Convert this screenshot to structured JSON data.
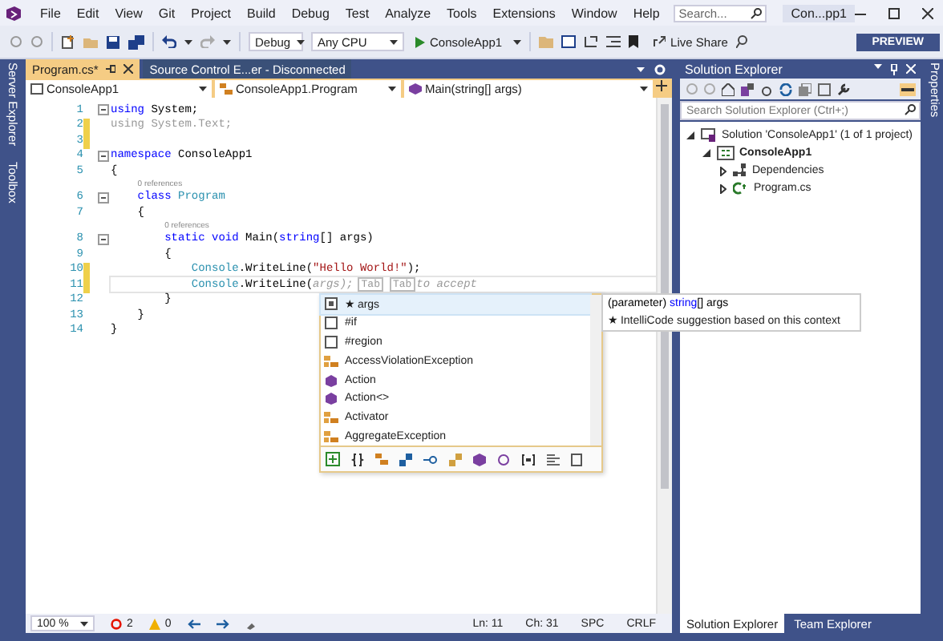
{
  "menu": {
    "items": [
      "File",
      "Edit",
      "View",
      "Git",
      "Project",
      "Build",
      "Debug",
      "Test",
      "Analyze",
      "Tools",
      "Extensions",
      "Window",
      "Help"
    ],
    "search": {
      "placeholder": "Search..."
    },
    "title": "Con...pp1"
  },
  "toolbar": {
    "config": "Debug",
    "platform": "Any CPU",
    "run_target": "ConsoleApp1",
    "live_share": "Live Share",
    "preview": "PREVIEW"
  },
  "side_left": [
    "Server Explorer",
    "Toolbox"
  ],
  "side_right": [
    "Properties"
  ],
  "tabs": [
    {
      "label": "Program.cs*",
      "selected": true
    },
    {
      "label": "Source Control E...er - Disconnected",
      "selected": false
    }
  ],
  "nav": [
    "ConsoleApp1",
    "ConsoleApp1.Program",
    "Main(string[] args)"
  ],
  "code": [
    {
      "kind": "line",
      "number": "1",
      "changed": false,
      "collapsible": true,
      "current": false,
      "tokens": [
        {
          "text": "using",
          "kind": "kw"
        },
        {
          "text": " System;",
          "kind": "plain"
        }
      ]
    },
    {
      "kind": "line",
      "number": "2",
      "changed": true,
      "collapsible": false,
      "current": false,
      "tokens": [
        {
          "text": "using System.Text;",
          "kind": "unused"
        }
      ]
    },
    {
      "kind": "line",
      "number": "3",
      "changed": true,
      "collapsible": false,
      "current": false
    },
    {
      "kind": "line",
      "number": "4",
      "changed": false,
      "collapsible": true,
      "current": false,
      "tokens": [
        {
          "text": "namespace",
          "kind": "kw"
        },
        {
          "text": " ConsoleApp1",
          "kind": "plain"
        }
      ]
    },
    {
      "kind": "line",
      "number": "5",
      "changed": false,
      "collapsible": false,
      "current": false,
      "tokens": [
        {
          "text": "{",
          "kind": "plain"
        }
      ]
    },
    {
      "kind": "codelens",
      "text": "0 references"
    },
    {
      "kind": "line",
      "number": "6",
      "changed": false,
      "collapsible": true,
      "current": false,
      "tokens": [
        {
          "text": "    class",
          "kind": "kw"
        },
        {
          "text": " Program",
          "kind": "type"
        }
      ]
    },
    {
      "kind": "line",
      "number": "7",
      "changed": false,
      "collapsible": false,
      "current": false,
      "tokens": [
        {
          "text": "    {",
          "kind": "plain"
        }
      ]
    },
    {
      "kind": "codelens",
      "text": "0 references"
    },
    {
      "kind": "line",
      "number": "8",
      "changed": false,
      "collapsible": true,
      "current": false,
      "tokens": [
        {
          "text": "        static void",
          "kind": "kw"
        },
        {
          "text": " Main(",
          "kind": "plain"
        },
        {
          "text": "string",
          "kind": "kw"
        },
        {
          "text": "[] args)",
          "kind": "plain"
        }
      ]
    },
    {
      "kind": "line",
      "number": "9",
      "changed": false,
      "collapsible": false,
      "current": false,
      "tokens": [
        {
          "text": "        {",
          "kind": "plain"
        }
      ]
    },
    {
      "kind": "line",
      "number": "10",
      "changed": true,
      "collapsible": false,
      "current": false,
      "tokens": [
        {
          "text": "            Console",
          "kind": "type"
        },
        {
          "text": ".WriteLine(",
          "kind": "plain"
        },
        {
          "text": "\"Hello World!\"",
          "kind": "str"
        },
        {
          "text": ");",
          "kind": "plain"
        }
      ]
    },
    {
      "kind": "line",
      "number": "11",
      "changed": true,
      "collapsible": false,
      "current": true,
      "tokens": [
        {
          "text": "            Console",
          "kind": "type"
        },
        {
          "text": ".WriteLine(",
          "kind": "plain"
        },
        {
          "text": "args);",
          "kind": "hint"
        },
        {
          "text": "Tab",
          "kind": "key"
        },
        {
          "text": "Tab",
          "kind": "key"
        },
        {
          "text": "to accept",
          "kind": "hint"
        }
      ]
    },
    {
      "kind": "line",
      "number": "12",
      "changed": false,
      "collapsible": false,
      "current": false,
      "tokens": [
        {
          "text": "        }",
          "kind": "plain"
        }
      ]
    },
    {
      "kind": "line",
      "number": "13",
      "changed": false,
      "collapsible": false,
      "current": false,
      "tokens": [
        {
          "text": "    }",
          "kind": "plain"
        }
      ]
    },
    {
      "kind": "line",
      "number": "14",
      "changed": false,
      "collapsible": false,
      "current": false,
      "tokens": [
        {
          "text": "}",
          "kind": "plain"
        }
      ]
    }
  ],
  "completion": {
    "items": [
      {
        "label": "★ args",
        "kind": "field",
        "selected": true
      },
      {
        "label": "#if",
        "kind": "snippet",
        "selected": false
      },
      {
        "label": "#region",
        "kind": "snippet",
        "selected": false
      },
      {
        "label": "AccessViolationException",
        "kind": "class",
        "selected": false
      },
      {
        "label": "Action",
        "kind": "delegate",
        "selected": false
      },
      {
        "label": "Action<>",
        "kind": "delegate",
        "selected": false
      },
      {
        "label": "Activator",
        "kind": "class",
        "selected": false
      },
      {
        "label": "AggregateException",
        "kind": "class",
        "selected": false
      }
    ]
  },
  "tooltip": {
    "signature": [
      {
        "text": "(parameter) ",
        "kind": "plain"
      },
      {
        "text": "string",
        "kind": "kw"
      },
      {
        "text": "[] args",
        "kind": "plain"
      }
    ],
    "note": "★ IntelliCode suggestion based on this context"
  },
  "solution_explorer": {
    "title": "Solution Explorer",
    "search": {
      "placeholder": "Search Solution Explorer (Ctrl+;)"
    },
    "tree": [
      {
        "label": "Solution 'ConsoleApp1' (1 of 1 project)",
        "kind": "solution",
        "expanded": true,
        "children": [
          {
            "label": "ConsoleApp1",
            "kind": "project",
            "expanded": true,
            "children": [
              {
                "label": "Dependencies",
                "kind": "dependencies",
                "expanded": false
              },
              {
                "label": "Program.cs",
                "kind": "csfile",
                "expanded": false
              }
            ]
          }
        ]
      }
    ]
  },
  "status_bar": {
    "zoom": "100 %",
    "errors": "2",
    "warnings": "0",
    "line": "Ln: 11",
    "column": "Ch: 31",
    "spacing": "SPC",
    "line_ending": "CRLF"
  },
  "bottom_tabs": [
    {
      "label": "Solution Explorer",
      "selected": true
    },
    {
      "label": "Team Explorer",
      "selected": false
    }
  ]
}
